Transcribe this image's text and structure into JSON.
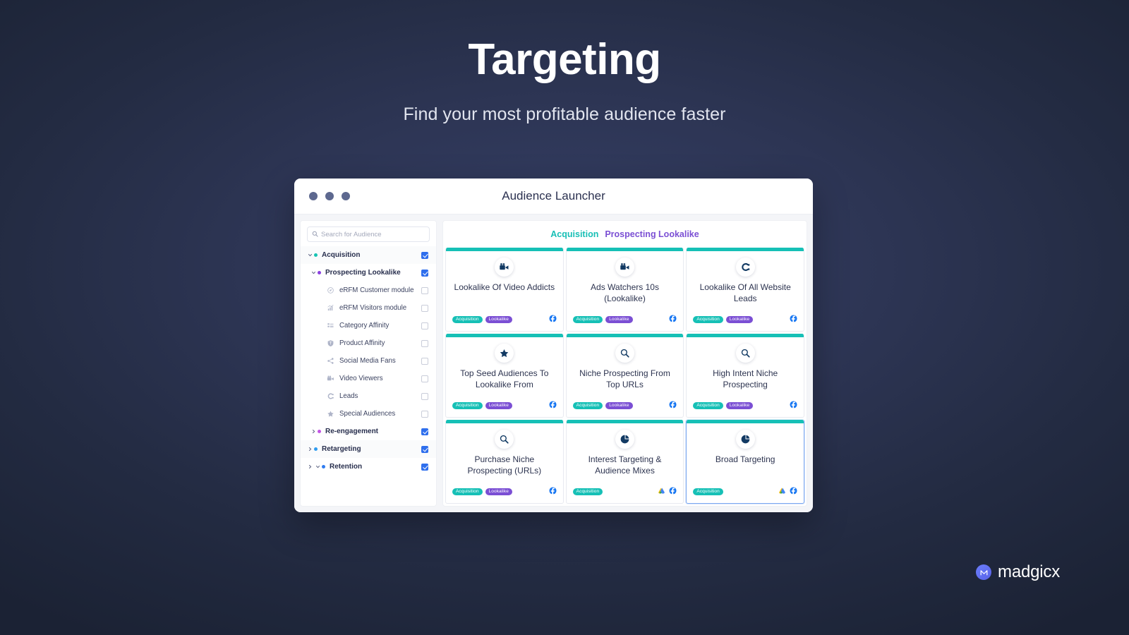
{
  "hero": {
    "title": "Targeting",
    "subtitle": "Find your most profitable audience faster"
  },
  "window": {
    "title": "Audience Launcher"
  },
  "search": {
    "value": "",
    "placeholder": "Search for Audience"
  },
  "sidebar": {
    "items": [
      {
        "label": "Acquisition",
        "level": 0,
        "type": "group",
        "chevron": "down",
        "bullet": "#17c4b4",
        "checked": true,
        "shaded": true,
        "icon": ""
      },
      {
        "label": "Prospecting Lookalike",
        "level": 1,
        "type": "group",
        "chevron": "down",
        "bullet": "#8b3fe0",
        "checked": true,
        "shaded": false,
        "icon": ""
      },
      {
        "label": "eRFM Customer module",
        "level": 2,
        "type": "leaf",
        "chevron": "none",
        "bullet": "",
        "checked": false,
        "shaded": false,
        "icon": "compass-icon"
      },
      {
        "label": "eRFM Visitors module",
        "level": 2,
        "type": "leaf",
        "chevron": "none",
        "bullet": "",
        "checked": false,
        "shaded": false,
        "icon": "bar-chart-icon"
      },
      {
        "label": "Category Affinity",
        "level": 2,
        "type": "leaf",
        "chevron": "none",
        "bullet": "",
        "checked": false,
        "shaded": false,
        "icon": "list-icon"
      },
      {
        "label": "Product Affinity",
        "level": 2,
        "type": "leaf",
        "chevron": "none",
        "bullet": "",
        "checked": false,
        "shaded": false,
        "icon": "shield-icon"
      },
      {
        "label": "Social Media Fans",
        "level": 2,
        "type": "leaf",
        "chevron": "none",
        "bullet": "",
        "checked": false,
        "shaded": false,
        "icon": "share-icon"
      },
      {
        "label": "Video Viewers",
        "level": 2,
        "type": "leaf",
        "chevron": "none",
        "bullet": "",
        "checked": false,
        "shaded": false,
        "icon": "video-camera-icon"
      },
      {
        "label": "Leads",
        "level": 2,
        "type": "leaf",
        "chevron": "none",
        "bullet": "",
        "checked": false,
        "shaded": false,
        "icon": "leads-icon"
      },
      {
        "label": "Special Audiences",
        "level": 2,
        "type": "leaf",
        "chevron": "none",
        "bullet": "",
        "checked": false,
        "shaded": false,
        "icon": "star-icon"
      },
      {
        "label": "Re-engagement",
        "level": 1,
        "type": "group",
        "chevron": "right",
        "bullet": "#c455e6",
        "checked": true,
        "shaded": false,
        "icon": ""
      },
      {
        "label": "Retargeting",
        "level": 0,
        "type": "group",
        "chevron": "right",
        "bullet": "#2f9cf0",
        "checked": true,
        "shaded": true,
        "icon": ""
      },
      {
        "label": "Retention",
        "level": 0,
        "type": "group",
        "chevron": "right-down",
        "bullet": "#2f7cf0",
        "checked": true,
        "shaded": false,
        "icon": ""
      }
    ]
  },
  "main": {
    "breadcrumb": {
      "acquisition": "Acquisition",
      "prospecting_lookalike": "Prospecting Lookalike"
    },
    "cards": [
      {
        "title": "Lookalike Of Video Addicts",
        "icon": "video-camera-icon",
        "tags": [
          "Acquisition",
          "Lookalike"
        ],
        "platforms": [
          "facebook"
        ],
        "selected": false
      },
      {
        "title": "Ads Watchers 10s (Lookalike)",
        "icon": "video-camera-icon",
        "tags": [
          "Acquisition",
          "Lookalike"
        ],
        "platforms": [
          "facebook"
        ],
        "selected": false
      },
      {
        "title": "Lookalike Of All Website Leads",
        "icon": "leads-icon",
        "tags": [
          "Acquisition",
          "Lookalike"
        ],
        "platforms": [
          "facebook"
        ],
        "selected": false
      },
      {
        "title": "Top Seed Audiences To Lookalike From",
        "icon": "star-icon",
        "tags": [
          "Acquisition",
          "Lookalike"
        ],
        "platforms": [
          "facebook"
        ],
        "selected": false
      },
      {
        "title": "Niche Prospecting From Top URLs",
        "icon": "magnifier-icon",
        "tags": [
          "Acquisition",
          "Lookalike"
        ],
        "platforms": [
          "facebook"
        ],
        "selected": false
      },
      {
        "title": "High Intent Niche Prospecting",
        "icon": "magnifier-icon",
        "tags": [
          "Acquisition",
          "Lookalike"
        ],
        "platforms": [
          "facebook"
        ],
        "selected": false
      },
      {
        "title": "Purchase Niche Prospecting (URLs)",
        "icon": "magnifier-icon",
        "tags": [
          "Acquisition",
          "Lookalike"
        ],
        "platforms": [
          "facebook"
        ],
        "selected": false
      },
      {
        "title": "Interest Targeting & Audience Mixes",
        "icon": "pie-chart-icon",
        "tags": [
          "Acquisition"
        ],
        "platforms": [
          "google-ads",
          "facebook"
        ],
        "selected": false
      },
      {
        "title": "Broad Targeting",
        "icon": "pie-chart-icon",
        "tags": [
          "Acquisition"
        ],
        "platforms": [
          "google-ads",
          "facebook"
        ],
        "selected": true
      }
    ]
  },
  "brand": {
    "name": "madgicx",
    "mark_letter": "M"
  },
  "colors": {
    "accent_teal": "#16c0b6",
    "accent_purple": "#7b4fd4",
    "selected_border": "#7aa7f0",
    "facebook_blue": "#1877f2",
    "page_bg_dark": "#1b2234",
    "page_bg_center": "#353f66"
  }
}
